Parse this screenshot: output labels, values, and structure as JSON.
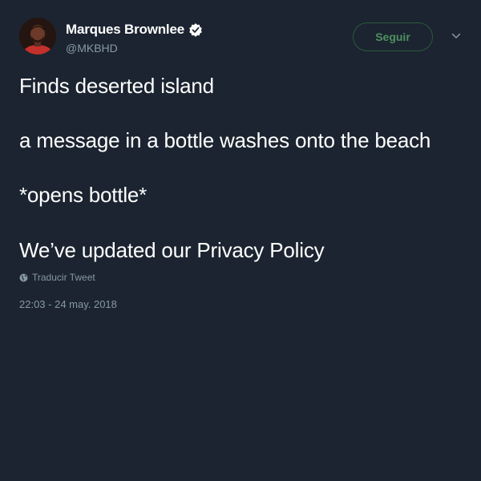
{
  "tweet": {
    "author": {
      "display_name": "Marques Brownlee",
      "handle": "@MKBHD"
    },
    "follow_label": "Seguir",
    "lines": [
      "Finds deserted island",
      "a message in a bottle washes onto the beach",
      "*opens bottle*",
      "We’ve updated our Privacy Policy"
    ],
    "translate_label": "Traducir Tweet",
    "timestamp": "22:03 - 24 may. 2018"
  },
  "colors": {
    "background": "#1b2430",
    "text": "#ffffff",
    "muted": "#8899a6",
    "follow_border": "#2b5b3a",
    "follow_text": "#4f8f60",
    "verified": "#ffffff"
  },
  "icons": [
    "avatar",
    "verified-badge-icon",
    "chevron-down-icon",
    "globe-icon"
  ]
}
